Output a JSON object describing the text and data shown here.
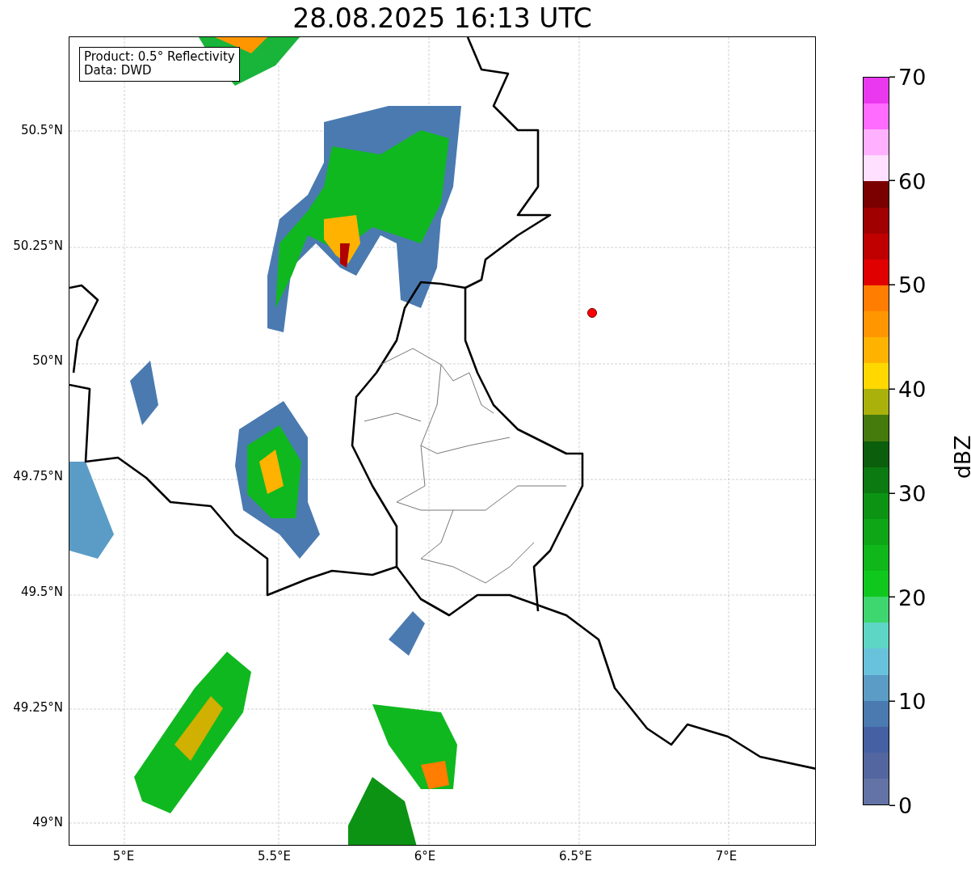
{
  "title": "28.08.2025 16:13 UTC",
  "legend": [
    "Product: 0.5° Reflectivity",
    "Data: DWD"
  ],
  "map": {
    "lat_ticks": [
      "50.5°N",
      "50.25°N",
      "50°N",
      "49.75°N",
      "49.5°N",
      "49.25°N",
      "49°N"
    ],
    "lon_ticks": [
      "5°E",
      "5.5°E",
      "6°E",
      "6.5°E",
      "7°E"
    ]
  },
  "colorbar": {
    "label": "dBZ",
    "ticks": [
      "70",
      "60",
      "50",
      "40",
      "30",
      "20",
      "10",
      "0"
    ],
    "bands": [
      {
        "color": "#ea38ee"
      },
      {
        "color": "#ff6cff"
      },
      {
        "color": "#ffb0ff"
      },
      {
        "color": "#ffe0ff"
      },
      {
        "color": "#7a0000"
      },
      {
        "color": "#a00000"
      },
      {
        "color": "#c00000"
      },
      {
        "color": "#e00000"
      },
      {
        "color": "#ff7d00"
      },
      {
        "color": "#ff9600"
      },
      {
        "color": "#ffb300"
      },
      {
        "color": "#ffd800"
      },
      {
        "color": "#aab10b"
      },
      {
        "color": "#457a0c"
      },
      {
        "color": "#0a5e0c"
      },
      {
        "color": "#0b7a10"
      },
      {
        "color": "#0c9314"
      },
      {
        "color": "#0ea617"
      },
      {
        "color": "#0fb71b"
      },
      {
        "color": "#10c81d"
      },
      {
        "color": "#3ed66e"
      },
      {
        "color": "#5ed6c5"
      },
      {
        "color": "#68c2dc"
      },
      {
        "color": "#5a9cc6"
      },
      {
        "color": "#4a7ab0"
      },
      {
        "color": "#4560a3"
      },
      {
        "color": "#5366a0"
      },
      {
        "color": "#6373a6"
      }
    ]
  }
}
